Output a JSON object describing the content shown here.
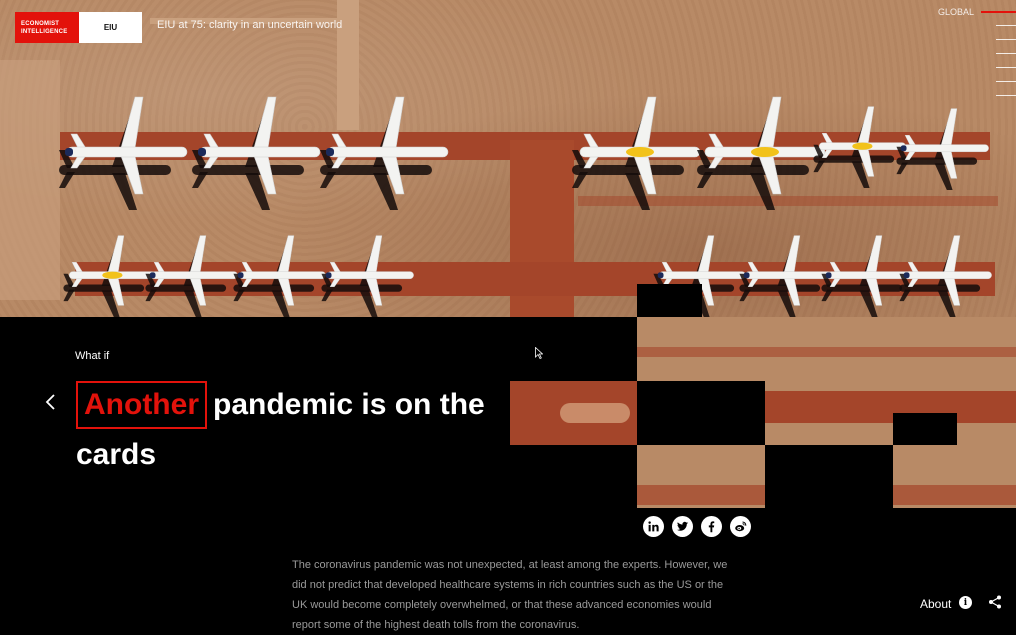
{
  "header": {
    "brand_line1": "ECONOMIST",
    "brand_line2": "INTELLIGENCE",
    "brand_short": "EIU",
    "title": "EIU at 75: clarity in an uncertain world",
    "region": "GLOBAL"
  },
  "hero": {
    "eyebrow": "What if",
    "highlight": "Another",
    "headline_rest": "pandemic is on the cards",
    "body": "The coronavirus pandemic was not unexpected, at least among the experts. However, we did not predict that developed healthcare systems in rich countries such as the US or the UK would become completely overwhelmed, or that these advanced economies would report some of the highest death tolls from the coronavirus."
  },
  "share": {
    "icons": [
      "linkedin-icon",
      "twitter-icon",
      "facebook-icon",
      "weibo-icon"
    ]
  },
  "footer": {
    "about_label": "About",
    "info_icon": "i"
  },
  "colors": {
    "accent": "#e3120b",
    "background": "#000000",
    "terrain": "#b88a66",
    "taxiway": "#a4452a"
  }
}
